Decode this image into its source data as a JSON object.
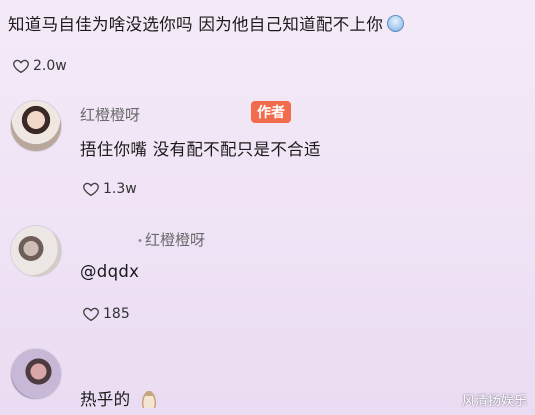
{
  "top_comment": {
    "text": "知道马自佳为啥没选你吗 因为他自己知道配不上你",
    "emoji": "crying-face",
    "likes": "2.0w"
  },
  "replies": [
    {
      "username": "红橙橙呀",
      "badge": "作者",
      "text": "捂住你嘴 没有配不配只是不合适",
      "likes": "1.3w"
    },
    {
      "username": "红橙橙呀",
      "text": "@dqdx",
      "likes": "185"
    },
    {
      "text": "热乎的",
      "emoji": "money-bag"
    }
  ],
  "watermark": "风清扬娱乐",
  "colors": {
    "badge": "#f26b4c",
    "background": "#f0e5f6"
  }
}
